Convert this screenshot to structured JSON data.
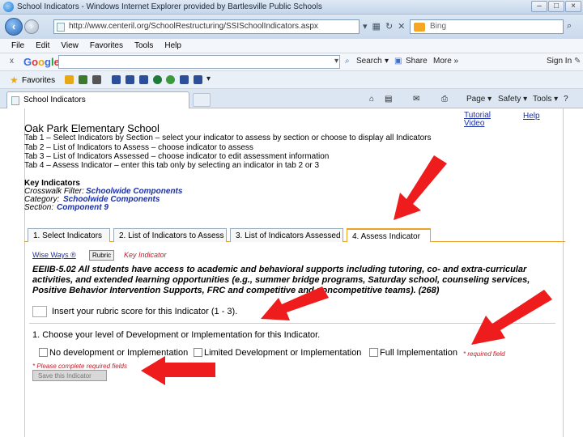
{
  "window": {
    "title": "School Indicators - Windows Internet Explorer provided by Bartlesville Public Schools"
  },
  "address_bar": {
    "url": "http://www.centeril.org/SchoolRestructuring/SSISchoolIndicators.aspx",
    "search_placeholder": "Bing"
  },
  "menu": [
    "File",
    "Edit",
    "View",
    "Favorites",
    "Tools",
    "Help"
  ],
  "google_toolbar": {
    "close": "x",
    "search_label": "Search",
    "share_label": "Share",
    "more_label": "More »",
    "sign_in_label": "Sign In"
  },
  "favorites_bar": {
    "label": "Favorites"
  },
  "tab_bar": {
    "tab_title": "School Indicators",
    "commands": [
      "Page ▾",
      "Safety ▾",
      "Tools ▾"
    ]
  },
  "page": {
    "top_links": {
      "tutorial": "Tutorial Video",
      "help": "Help"
    },
    "school_name": "Oak Park Elementary School",
    "instructions": [
      "Tab 1 – Select Indicators by Section – select your indicator to assess by section or choose to display all Indicators",
      "Tab 2 – List of Indicators to Assess – choose indicator to assess",
      "Tab 3 – List of Indicators Assessed – choose indicator to edit assessment information",
      "Tab 4 – Assess Indicator – enter this tab only by selecting an indicator in tab 2 or 3"
    ],
    "key_indicators": {
      "heading": "Key Indicators",
      "crosswalk_label": "Crosswalk Filter:",
      "crosswalk_value": "Schoolwide Components",
      "category_label": "Category:",
      "category_value": "Schoolwide Components",
      "section_label": "Section:",
      "section_value": "Component 9"
    },
    "tabs": [
      {
        "label": "1. Select Indicators",
        "active": false
      },
      {
        "label": "2. List of Indicators to Assess",
        "active": false
      },
      {
        "label": "3. List of Indicators Assessed",
        "active": false
      },
      {
        "label": "4. Assess Indicator",
        "active": true
      }
    ],
    "wise_ways_link": "Wise Ways ®",
    "rubric_button": "Rubric",
    "key_indicator_label": "Key Indicator",
    "indicator_text": "EEIIB-5.02 All students have access to academic and behavioral supports including tutoring, co- and extra-curricular activities, and extended learning opportunities (e.g., summer bridge programs, Saturday school, counseling services, Positive Behavior Intervention Supports, FRC and competitive and noncompetitive teams). (268)",
    "rubric_prompt": "Insert your rubric score for this Indicator (1 - 3).",
    "level_prompt": "1. Choose your level of Development or Implementation for this Indicator.",
    "options": [
      "No development or Implementation",
      "Limited Development or Implementation",
      "Full Implementation"
    ],
    "required_field": "* required field",
    "complete_fields": "* Please complete required fields",
    "save_button": "Save this Indicator"
  },
  "colors": {
    "annotation_arrow": "#ee1c1c",
    "active_tab_border": "#e8a227"
  }
}
